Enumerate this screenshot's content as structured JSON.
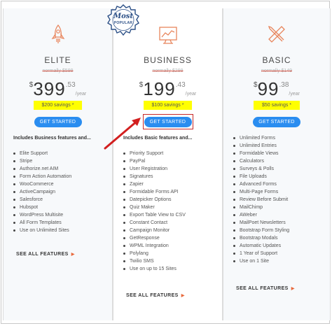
{
  "badge": {
    "line1": "Most",
    "line2": "POPULAR"
  },
  "colors": {
    "accent": "#2a8df0",
    "savings": "#ffff00",
    "highlight": "#c62828",
    "icon": "#e8855c"
  },
  "plans": [
    {
      "name": "ELITE",
      "icon": "rocket-icon",
      "was": "normally $599",
      "currency": "$",
      "amount": "399",
      "cents": ".53",
      "per": "/year",
      "savings": "$200 savings *",
      "cta": "GET STARTED",
      "includes": "Includes Business features and...",
      "features": [
        "Elite Support",
        "Stripe",
        "Authorize.net AIM",
        "Form Action Automation",
        "WooCommerce",
        "ActiveCampaign",
        "Salesforce",
        "Hubspot",
        "WordPress Multisite",
        "All Form Templates",
        "Use on Unlimited Sites"
      ],
      "see_all": "SEE ALL FEATURES"
    },
    {
      "name": "BUSINESS",
      "icon": "chart-icon",
      "was": "normally $299",
      "currency": "$",
      "amount": "199",
      "cents": ".43",
      "per": "/year",
      "savings": "$100 savings *",
      "cta": "GET STARTED",
      "includes": "Includes Basic features and...",
      "features": [
        "Priority Support",
        "PayPal",
        "User Registration",
        "Signatures",
        "Zapier",
        "Formidable Forms API",
        "Datepicker Options",
        "Quiz Maker",
        "Export Table View to CSV",
        "Constant Contact",
        "Campaign Monitor",
        "GetResponse",
        "WPML Integration",
        "Polylang",
        "Twilio SMS",
        "Use on up to 15 Sites"
      ],
      "see_all": "SEE ALL FEATURES"
    },
    {
      "name": "BASIC",
      "icon": "pencil-ruler-icon",
      "was": "normally $149",
      "currency": "$",
      "amount": "99",
      "cents": ".38",
      "per": "/year",
      "savings": "$50 savings *",
      "cta": "GET STARTED",
      "includes": "",
      "features": [
        "Unlimited Forms",
        "Unlimited Entries",
        "Formidable Views",
        "Calculators",
        "Surveys & Polls",
        "File Uploads",
        "Advanced Forms",
        "Multi-Page Forms",
        "Review Before Submit",
        "MailChimp",
        "AWeber",
        "MailPoet Newsletters",
        "Bootstrap Form Styling",
        "Bootstrap Modals",
        "Automatic Updates",
        "1 Year of Support",
        "Use on 1 Site"
      ],
      "see_all": "SEE ALL FEATURES"
    }
  ]
}
